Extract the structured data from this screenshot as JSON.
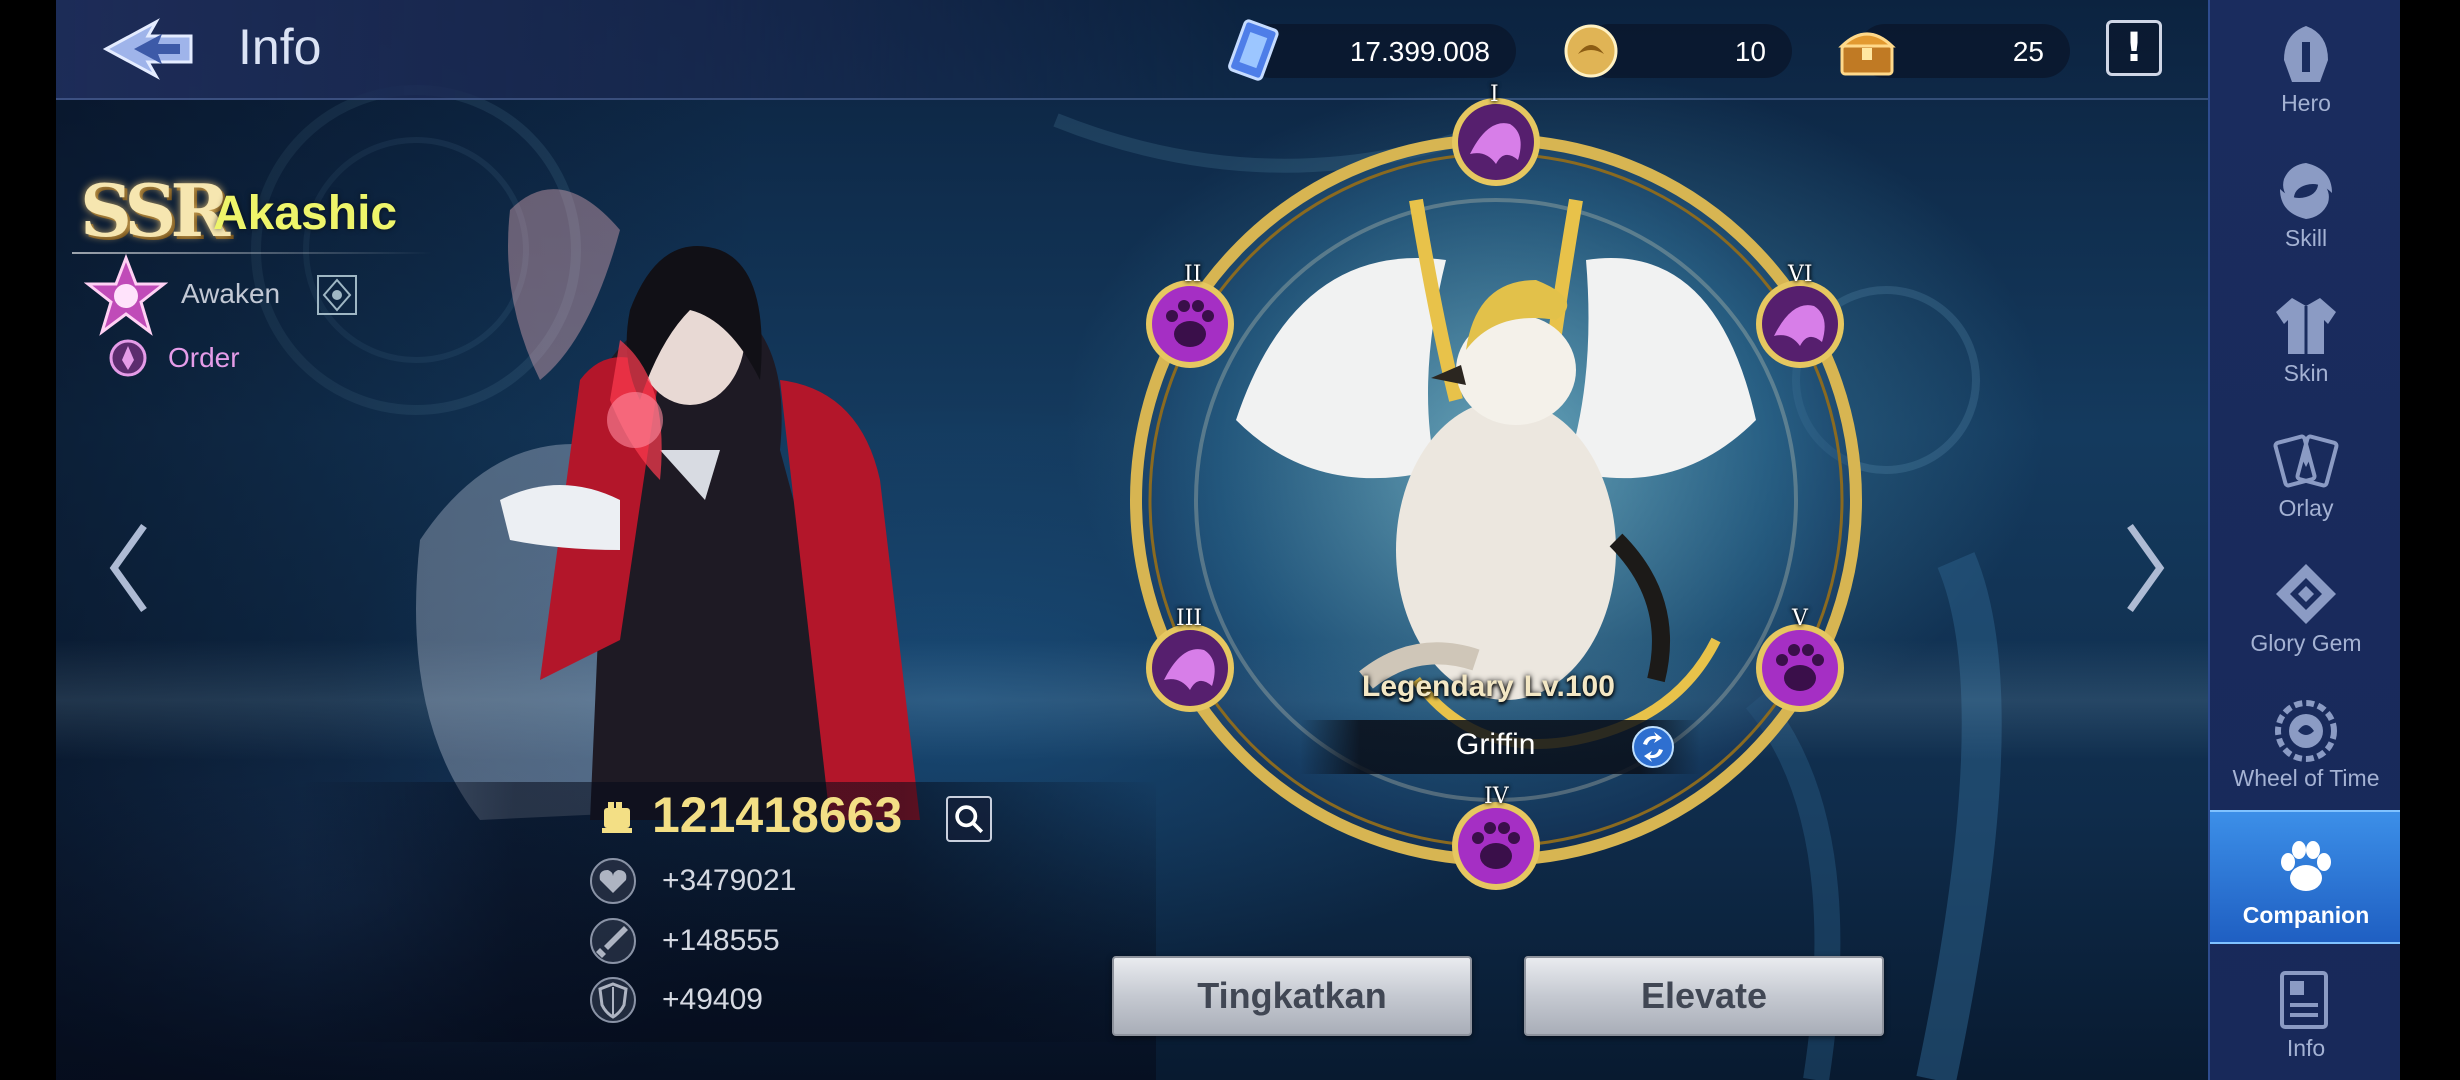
{
  "header": {
    "title": "Info",
    "currencies": [
      {
        "icon": "crystal-icon",
        "value": "17.399.008"
      },
      {
        "icon": "gold-coin-icon",
        "value": "10"
      },
      {
        "icon": "treasure-chest-icon",
        "value": "25"
      }
    ],
    "alert_label": "!"
  },
  "hero": {
    "rarity": "SSR",
    "name": "Akashic",
    "awaken_label": "Awaken",
    "faction_label": "Order"
  },
  "stats": {
    "combat_power": "121418663",
    "hp": "+3479021",
    "attack": "+148555",
    "defense": "+49409"
  },
  "companion": {
    "rarity": "Legendary",
    "level": "Lv.100",
    "name": "Griffin",
    "nodes": [
      {
        "numeral": "I",
        "icon": "dark-beast-rune-icon"
      },
      {
        "numeral": "II",
        "icon": "paw-rune-icon"
      },
      {
        "numeral": "III",
        "icon": "dark-beast-rune-icon"
      },
      {
        "numeral": "IV",
        "icon": "paw-rune-icon"
      },
      {
        "numeral": "V",
        "icon": "paw-rune-icon"
      },
      {
        "numeral": "VI",
        "icon": "dark-beast-rune-icon"
      }
    ]
  },
  "buttons": {
    "upgrade": "Tingkatkan",
    "elevate": "Elevate"
  },
  "sidebar": {
    "items": [
      {
        "label": "Hero",
        "icon": "hero-helmet-icon"
      },
      {
        "label": "Skill",
        "icon": "skill-swirl-icon"
      },
      {
        "label": "Skin",
        "icon": "skin-jacket-icon"
      },
      {
        "label": "Orlay",
        "icon": "orlay-cards-icon"
      },
      {
        "label": "Glory Gem",
        "icon": "glory-gem-icon"
      },
      {
        "label": "Wheel of Time",
        "icon": "wheel-of-time-icon"
      },
      {
        "label": "Companion",
        "icon": "paw-icon",
        "active": true
      },
      {
        "label": "Info",
        "icon": "info-book-icon"
      }
    ]
  },
  "colors": {
    "accent_active": "#3c8fe8",
    "name_yellow": "#eef56a",
    "cp_gold": "#f3df85",
    "order_pink": "#e59ce8",
    "ring_gold": "#d7b552",
    "rune_purple": "#a52fc4"
  }
}
